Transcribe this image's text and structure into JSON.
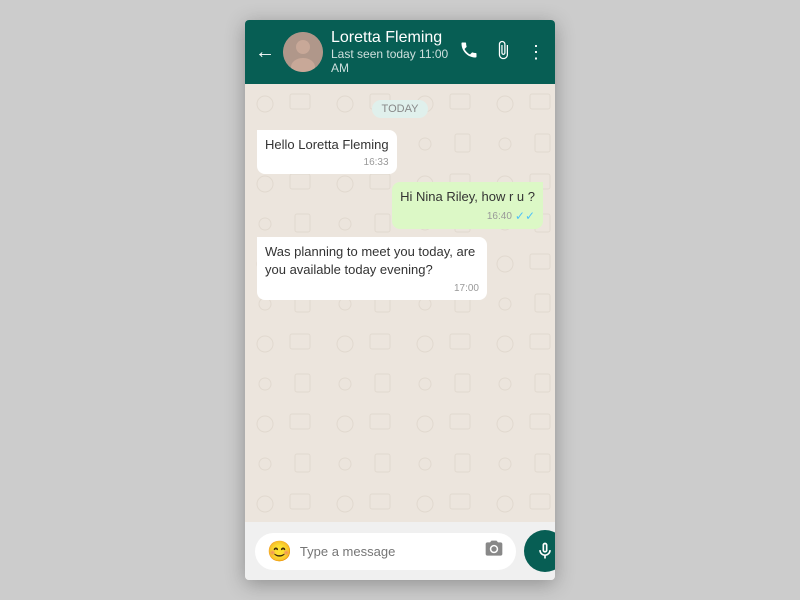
{
  "header": {
    "contact_name": "Loretta Fleming",
    "contact_status": "Last seen today 11:00 AM",
    "back_label": "←",
    "call_icon": "📞",
    "attach_icon": "📎",
    "menu_icon": "⋮"
  },
  "chat": {
    "date_label": "TODAY",
    "messages": [
      {
        "id": 1,
        "type": "received",
        "text": "Hello Loretta Fleming",
        "time": "16:33",
        "ticks": ""
      },
      {
        "id": 2,
        "type": "sent",
        "text": "Hi Nina Riley, how r u ?",
        "time": "16:40",
        "ticks": "✓✓"
      },
      {
        "id": 3,
        "type": "received",
        "text": "Was planning to meet you today, are you available today evening?",
        "time": "17:00",
        "ticks": ""
      }
    ]
  },
  "input": {
    "placeholder": "Type a message",
    "emoji_icon": "😊",
    "camera_icon": "📷",
    "mic_icon": "🎤"
  }
}
